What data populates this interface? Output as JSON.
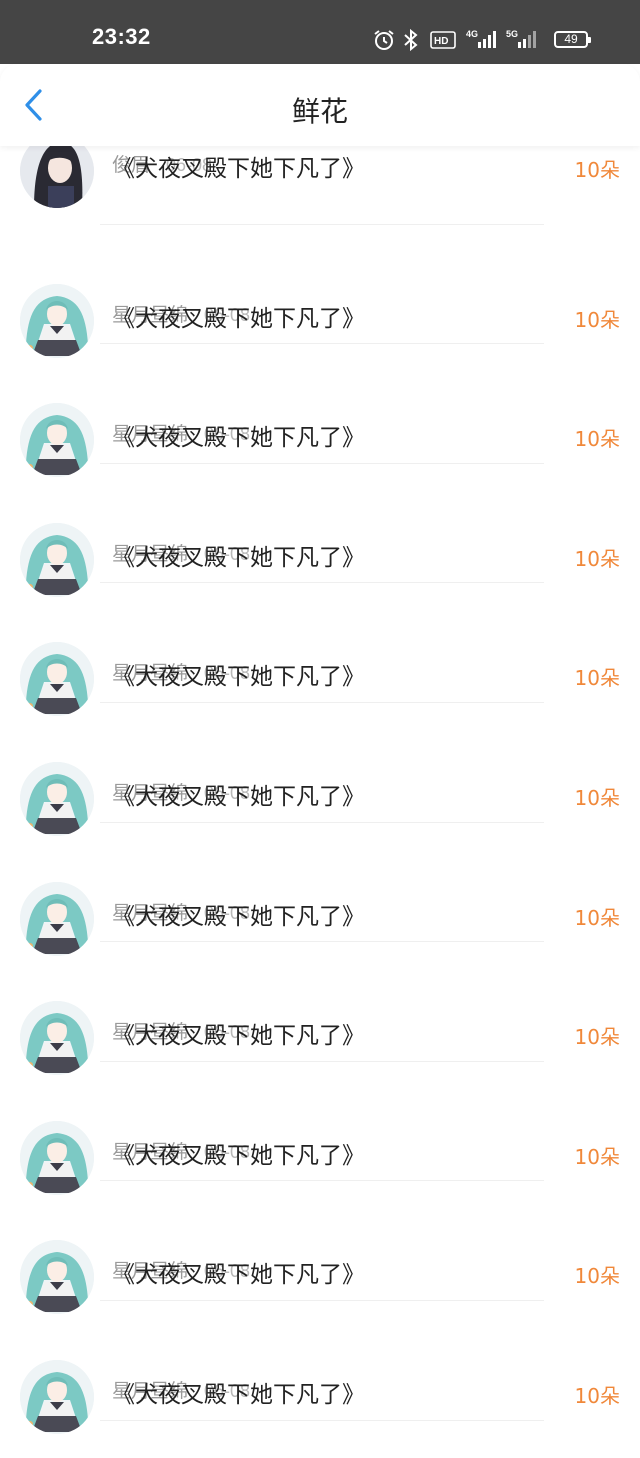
{
  "status": {
    "time": "23:32",
    "battery": "49",
    "network_labels": [
      "HD",
      "4G",
      "5G"
    ]
  },
  "header": {
    "title": "鲜花"
  },
  "colors": {
    "accent": "#2f8fe8",
    "count": "#f0883a"
  },
  "items": [
    {
      "user": "俊眉",
      "date": "06-08",
      "book": "《犬夜叉殿下她下凡了》",
      "count": "10朵",
      "avatar": "dark-hair-avatar"
    },
    {
      "user": "星月昼绵",
      "date": "06-08",
      "book": "《犬夜叉殿下她下凡了》",
      "count": "10朵",
      "avatar": "teal-hair-avatar"
    },
    {
      "user": "星月昼绵",
      "date": "06-08",
      "book": "《犬夜叉殿下她下凡了》",
      "count": "10朵",
      "avatar": "teal-hair-avatar"
    },
    {
      "user": "星月昼绵",
      "date": "06-08",
      "book": "《犬夜叉殿下她下凡了》",
      "count": "10朵",
      "avatar": "teal-hair-avatar"
    },
    {
      "user": "星月昼绵",
      "date": "06-08",
      "book": "《犬夜叉殿下她下凡了》",
      "count": "10朵",
      "avatar": "teal-hair-avatar"
    },
    {
      "user": "星月昼绵",
      "date": "06-08",
      "book": "《犬夜叉殿下她下凡了》",
      "count": "10朵",
      "avatar": "teal-hair-avatar"
    },
    {
      "user": "星月昼绵",
      "date": "06-08",
      "book": "《犬夜叉殿下她下凡了》",
      "count": "10朵",
      "avatar": "teal-hair-avatar"
    },
    {
      "user": "星月昼绵",
      "date": "06-08",
      "book": "《犬夜叉殿下她下凡了》",
      "count": "10朵",
      "avatar": "teal-hair-avatar"
    },
    {
      "user": "星月昼绵",
      "date": "06-08",
      "book": "《犬夜叉殿下她下凡了》",
      "count": "10朵",
      "avatar": "teal-hair-avatar"
    },
    {
      "user": "星月昼绵",
      "date": "06-08",
      "book": "《犬夜叉殿下她下凡了》",
      "count": "10朵",
      "avatar": "teal-hair-avatar"
    },
    {
      "user": "星月昼绵",
      "date": "06-08",
      "book": "《犬夜叉殿下她下凡了》",
      "count": "10朵",
      "avatar": "teal-hair-avatar"
    }
  ]
}
